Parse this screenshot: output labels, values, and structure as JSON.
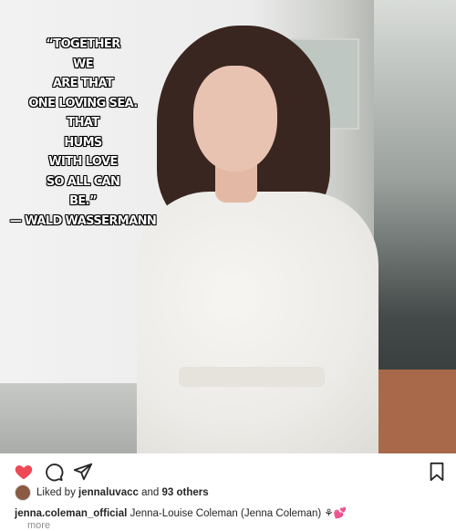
{
  "post": {
    "quote_text": "“TOGETHER\nWE\nARE THAT\nONE LOVING SEA.\nTHAT\nHUMS\nWITH LOVE\nSO ALL CAN\nBE.”\n— WALD WASSERMANN",
    "liked_prefix": "Liked by",
    "liked_user": "jennaluvacc",
    "liked_and": "and",
    "liked_others": "93 others",
    "caption_user": "jenna.coleman_official",
    "caption_text": "Jenna-Louise Coleman (Jenna Coleman) ⚘💕",
    "more_label": "more"
  },
  "icons": {
    "like": "heart-icon",
    "comment": "comment-icon",
    "share": "send-icon",
    "save": "bookmark-icon"
  },
  "colors": {
    "heart": "#ed4956",
    "text": "#262626",
    "muted": "#8e8e8e"
  }
}
